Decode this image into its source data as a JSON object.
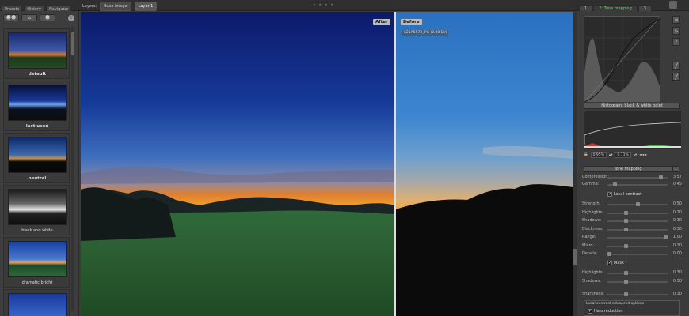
{
  "left_tabs": [
    "Presets",
    "History",
    "Navigator"
  ],
  "layers": {
    "label": "Layers:",
    "buttons": [
      "Base image",
      "Layer 1"
    ]
  },
  "right_tabs": [
    "1",
    "2: Tone mapping",
    "3"
  ],
  "presets": [
    {
      "label": "default"
    },
    {
      "label": "last used"
    },
    {
      "label": "neutral"
    },
    {
      "label": "black and white"
    },
    {
      "label": "dramatic bright"
    }
  ],
  "image": {
    "after_label": "After",
    "before_label": "Before",
    "file_info": "625A5572.JPG (0.00 EV)"
  },
  "right_panel": {
    "histogram_header": "Histogram: black & white point",
    "hist_left_value": "0.95%",
    "hist_right_value": "0.11%",
    "tone_mapping_header": "Tone mapping",
    "sliders_top": [
      {
        "label": "Compression:",
        "value": "3.57",
        "pos": 0.92
      },
      {
        "label": "Gamma:",
        "value": "0.45",
        "pos": 0.1
      }
    ],
    "local_contrast_label": "Local contrast",
    "sliders_local": [
      {
        "label": "Strength:",
        "value": "0.50",
        "pos": 0.5
      },
      {
        "label": "Highlights:",
        "value": "0.30",
        "pos": 0.3
      },
      {
        "label": "Shadows:",
        "value": "0.30",
        "pos": 0.3
      },
      {
        "label": "Blackness:",
        "value": "0.30",
        "pos": 0.3
      },
      {
        "label": "Range:",
        "value": "1.00",
        "pos": 1.0
      },
      {
        "label": "Micro:",
        "value": "0.30",
        "pos": 0.3
      },
      {
        "label": "Details:",
        "value": "0.00",
        "pos": 0.0
      }
    ],
    "mask_label": "Mask",
    "sliders_mask": [
      {
        "label": "Highlights:",
        "value": "0.30",
        "pos": 0.3
      },
      {
        "label": "Shadows:",
        "value": "0.30",
        "pos": 0.3
      }
    ],
    "sharpness": {
      "label": "Sharpness:",
      "value": "0.30",
      "pos": 0.3
    },
    "advanced_title": "Local contrast advanced options",
    "halo_label": "Halo reduction"
  }
}
